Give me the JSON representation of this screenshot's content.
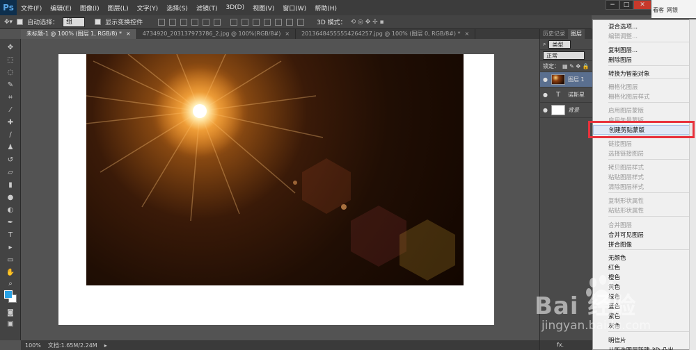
{
  "app": {
    "logo": "Ps"
  },
  "menu": [
    "文件(F)",
    "编辑(E)",
    "图像(I)",
    "图层(L)",
    "文字(Y)",
    "选择(S)",
    "滤镜(T)",
    "3D(D)",
    "视图(V)",
    "窗口(W)",
    "帮助(H)"
  ],
  "browser": {
    "label1": "看客",
    "label2": "网银"
  },
  "options": {
    "auto_select_label": "自动选择：",
    "auto_select_value": "组",
    "show_transform_label": "显示变换控件",
    "mode_3d_label": "3D 模式："
  },
  "tabs": [
    {
      "label": "未标题-1 @ 100% (图层 1, RGB/8) *",
      "close": "×"
    },
    {
      "label": "4734920_203137973786_2.jpg @ 100%(RGB/8#)",
      "close": "×"
    },
    {
      "label": "20136484555554264257.jpg @ 100% (图层 0, RGB/8#) *",
      "close": "×"
    }
  ],
  "status": {
    "zoom": "100%",
    "doc": "文档:1.65M/2.24M"
  },
  "panels": {
    "tabs": [
      "历史记录",
      "图层"
    ],
    "filter_value": "类型",
    "blend_mode": "正常",
    "lock_label": "锁定：",
    "layers": [
      {
        "name": "图层 1",
        "eye": "●",
        "kind": "image"
      },
      {
        "name": "诺斯星",
        "eye": "●",
        "kind": "text",
        "kind_mark": "T"
      },
      {
        "name": "背景",
        "eye": "●",
        "kind": "bg"
      }
    ],
    "bottom": "fx."
  },
  "context_menu": {
    "items": [
      {
        "label": "混合选项...",
        "disabled": false
      },
      {
        "label": "编辑调整...",
        "disabled": true
      },
      {
        "label": "复制图层...",
        "disabled": false
      },
      {
        "label": "删除图层",
        "disabled": false
      },
      {
        "label": "转换为智能对象",
        "disabled": false
      },
      {
        "label": "栅格化图层",
        "disabled": true
      },
      {
        "label": "栅格化图层样式",
        "disabled": true
      },
      {
        "label": "启用图层蒙版",
        "disabled": true
      },
      {
        "label": "启用矢量蒙版",
        "disabled": true
      },
      {
        "label": "创建剪贴蒙版",
        "disabled": false,
        "highlighted": true
      },
      {
        "label": "链接图层",
        "disabled": true
      },
      {
        "label": "选择链接图层",
        "disabled": true
      },
      {
        "label": "拷贝图层样式",
        "disabled": true
      },
      {
        "label": "粘贴图层样式",
        "disabled": true
      },
      {
        "label": "清除图层样式",
        "disabled": true
      },
      {
        "label": "复制形状属性",
        "disabled": true
      },
      {
        "label": "粘贴形状属性",
        "disabled": true
      },
      {
        "label": "合并图层",
        "disabled": true
      },
      {
        "label": "合并可见图层",
        "disabled": false
      },
      {
        "label": "拼合图像",
        "disabled": false
      },
      {
        "label": "无颜色",
        "disabled": false
      },
      {
        "label": "红色",
        "disabled": false
      },
      {
        "label": "橙色",
        "disabled": false
      },
      {
        "label": "黄色",
        "disabled": false
      },
      {
        "label": "绿色",
        "disabled": false
      },
      {
        "label": "蓝色",
        "disabled": false
      },
      {
        "label": "紫色",
        "disabled": false
      },
      {
        "label": "灰色",
        "disabled": false
      },
      {
        "label": "明信片",
        "disabled": false
      },
      {
        "label": "从所选图层新建 3D 凸出",
        "disabled": false
      }
    ]
  },
  "watermark": {
    "brand": "Bai 经验",
    "url": "jingyan.baidu.com"
  },
  "colors": {
    "foreground": "#29a2e6",
    "background": "#ffffff",
    "highlight_box": "#e8323c"
  }
}
